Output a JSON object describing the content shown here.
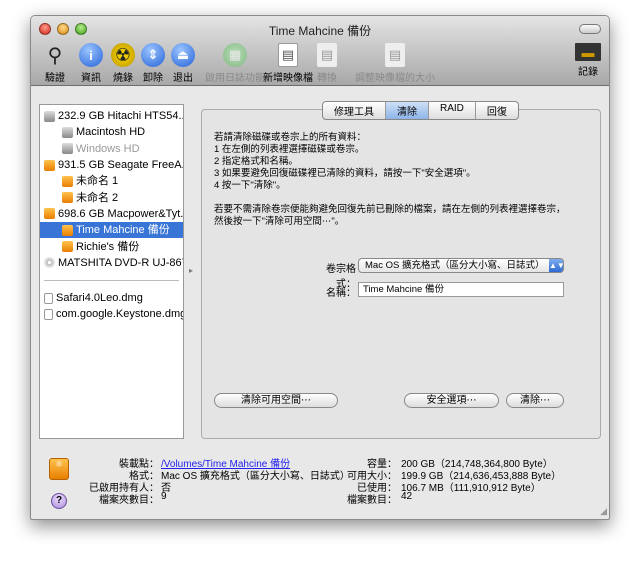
{
  "window": {
    "title": "Time Mahcine 備份"
  },
  "toolbar": [
    {
      "label": "驗證",
      "icon": "microscope-icon",
      "enabled": true
    },
    {
      "label": "資訊",
      "icon": "info-icon",
      "enabled": true
    },
    {
      "label": "燒錄",
      "icon": "burn-icon",
      "enabled": true
    },
    {
      "label": "卸除",
      "icon": "unmount-icon",
      "enabled": true
    },
    {
      "label": "退出",
      "icon": "eject-icon",
      "enabled": true
    },
    {
      "label": "啟用日誌功能",
      "icon": "journal-icon",
      "enabled": false
    },
    {
      "label": "新增映像檔",
      "icon": "new-image-icon",
      "enabled": true
    },
    {
      "label": "轉換",
      "icon": "convert-icon",
      "enabled": false
    },
    {
      "label": "調整映像檔的大小",
      "icon": "resize-image-icon",
      "enabled": false
    },
    {
      "label": "記錄",
      "icon": "log-icon",
      "enabled": true
    }
  ],
  "sidebar": {
    "items": [
      {
        "label": "232.9 GB Hitachi HTS54...",
        "kind": "hd",
        "level": 1
      },
      {
        "label": "Macintosh HD",
        "kind": "hd",
        "level": 2
      },
      {
        "label": "Windows HD",
        "kind": "hd",
        "level": 2,
        "dimmed": true
      },
      {
        "label": "931.5 GB Seagate FreeA...",
        "kind": "ext",
        "level": 1
      },
      {
        "label": "未命名 1",
        "kind": "ext",
        "level": 2
      },
      {
        "label": "未命名 2",
        "kind": "ext",
        "level": 2
      },
      {
        "label": "698.6 GB Macpower&Tyt...",
        "kind": "ext",
        "level": 1
      },
      {
        "label": "Time Mahcine 備份",
        "kind": "ext",
        "level": 2,
        "selected": true
      },
      {
        "label": "Richie's 備份",
        "kind": "ext",
        "level": 2
      },
      {
        "label": "MATSHITA DVD-R UJ-867",
        "kind": "cd",
        "level": 1
      }
    ],
    "images": [
      {
        "label": "Safari4.0Leo.dmg"
      },
      {
        "label": "com.google.Keystone.dmg"
      }
    ]
  },
  "tabs": [
    {
      "label": "修理工具"
    },
    {
      "label": "清除",
      "active": true
    },
    {
      "label": "RAID"
    },
    {
      "label": "回復"
    }
  ],
  "erase": {
    "instructions": [
      "若請清除磁碟或卷宗上的所有資料：",
      "1  在左側的列表裡選擇磁碟或卷宗。",
      "2  指定格式和名稱。",
      "3  如果要避免回復磁碟裡已清除的資料，請按一下\"安全選項\"。",
      "4  按一下\"清除\"。"
    ],
    "free_space_note": "若要不需清除卷宗便能夠避免回復先前已刪除的檔案，請在左側的列表裡選擇卷宗，然後按一下\"清除可用空間⋯\"。",
    "format_label": "卷宗格式：",
    "format_value": "Mac OS 擴充格式（區分大小寫、日誌式）",
    "name_label": "名稱：",
    "name_value": "Time Mahcine 備份",
    "erase_free_space_button": "清除可用空間⋯",
    "security_options_button": "安全選項⋯",
    "erase_button": "清除⋯"
  },
  "info": {
    "mount_point_label": "裝載點：",
    "mount_point": "/Volumes/Time Mahcine 備份",
    "format_label": "格式：",
    "format": "Mac OS 擴充格式（區分大小寫、日誌式）",
    "owners_label": "已啟用持有人：",
    "owners": "否",
    "folders_label": "檔案夾數目：",
    "folders": "9",
    "capacity_label": "容量：",
    "capacity": "200 GB（214,748,364,800 Byte）",
    "available_label": "可用大小：",
    "available": "199.9 GB（214,636,453,888 Byte）",
    "used_label": "已使用：",
    "used": "106.7 MB（111,910,912 Byte）",
    "files_label": "檔案數目：",
    "files": "42"
  },
  "colors": {
    "selection": "#3875d7",
    "link": "#2222ee",
    "tab_active": "#8db4e8"
  }
}
